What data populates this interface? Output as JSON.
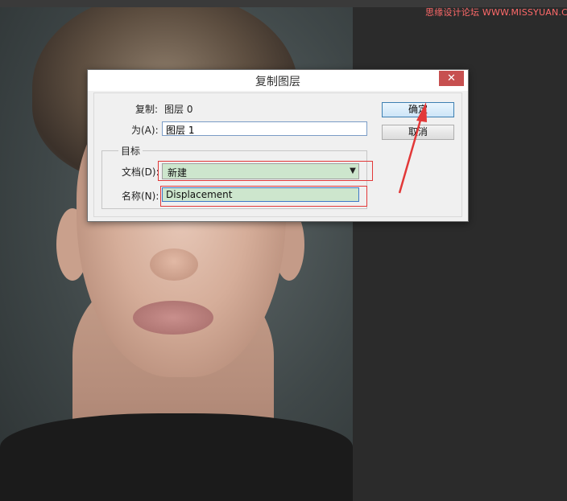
{
  "watermark": "思缘设计论坛 WWW.MISSYUAN.COM",
  "dialog": {
    "title": "复制图层",
    "close_symbol": "✕",
    "copy_label": "复制:",
    "copy_value": "图层 0",
    "as_label": "为(A):",
    "as_value": "图层 1",
    "target_group": "目标",
    "document_label": "文档(D):",
    "document_value": "新建",
    "name_label": "名称(N):",
    "name_value": "Displacement",
    "ok_label": "确定",
    "cancel_label": "取消"
  },
  "colors": {
    "highlight_green": "#cde6cd",
    "annotation_red": "#e23838",
    "close_red": "#c75050"
  },
  "icons": {
    "close": "close-icon",
    "dropdown": "chevron-down-icon",
    "annotation": "arrow-annotation-icon"
  }
}
